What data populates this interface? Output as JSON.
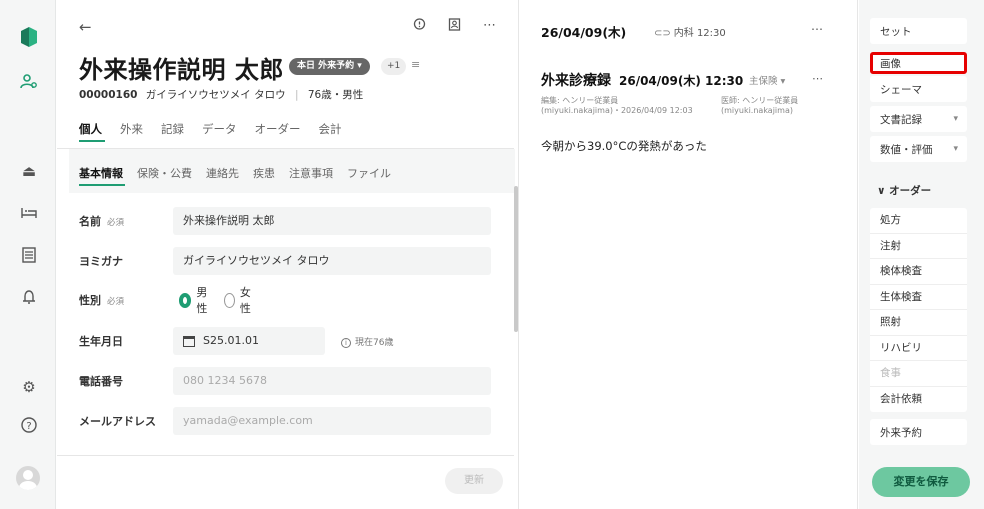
{
  "patient": {
    "back_icon": "arrow-left-icon",
    "name": "外来操作説明 太郎",
    "badge_appointment": "本日 外来予約 ▾",
    "badge_count": "+1",
    "badge_menu_icon": "menu-icon",
    "id": "00000160",
    "kana": "ガイライソウセツメイ タロウ",
    "age_sex": "76歳・男性",
    "main_tabs": [
      "個人",
      "外来",
      "記録",
      "データ",
      "オーダー",
      "会計"
    ],
    "sub_tabs": [
      "基本情報",
      "保険・公費",
      "連絡先",
      "疾患",
      "注意事項",
      "ファイル"
    ],
    "fields": {
      "name_label": "名前",
      "name_req": "必須",
      "name_value": "外来操作説明 太郎",
      "kana_label": "ヨミガナ",
      "kana_value": "ガイライソウセツメイ タロウ",
      "sex_label": "性別",
      "sex_req": "必須",
      "sex_male": "男性",
      "sex_female": "女性",
      "dob_label": "生年月日",
      "dob_value": "S25.01.01",
      "dob_note": "現在76歳",
      "phone_label": "電話番号",
      "phone_placeholder": "080 1234 5678",
      "email_label": "メールアドレス",
      "email_placeholder": "yamada@example.com"
    },
    "update_button": "更新"
  },
  "record": {
    "date_header": "26/04/09(木)",
    "dept": "内科 12:30",
    "title": "外来診療録",
    "title_datetime": "26/04/09(木) 12:30",
    "insurance": "主保険 ▾",
    "editor_label": "編集: ヘンリー従業員",
    "editor_meta": "(miyuki.nakajima)・2026/04/09 12:03",
    "doctor_label": "医師: ヘンリー従業員",
    "doctor_meta": "(miyuki.nakajima)",
    "body": "今朝から39.0°Cの発熱があった"
  },
  "orders": {
    "set": "セット",
    "image": "画像",
    "schema": "シェーマ",
    "doc_record": "文書記録",
    "value_eval": "数値・評価",
    "section": "∨ オーダー",
    "items": [
      "処方",
      "注射",
      "検体検査",
      "生体検査",
      "照射",
      "リハビリ",
      "食事",
      "会計依頼"
    ],
    "appointment": "外来予約",
    "save_button": "変更を保存"
  },
  "colors": {
    "accent": "#1f9d73",
    "highlight": "#e60000"
  }
}
